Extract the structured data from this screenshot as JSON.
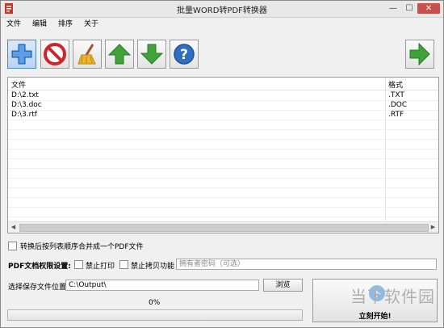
{
  "window": {
    "title": "批量WORD转PDF转换器",
    "minimize": "—",
    "maximize": "☐",
    "close": "✕"
  },
  "menu": [
    "文件",
    "编辑",
    "排序",
    "关于"
  ],
  "toolbar": {
    "buttons": [
      "add-icon",
      "delete-icon",
      "clear-icon",
      "move-up-icon",
      "move-down-icon",
      "help-icon"
    ],
    "next": "next-arrow-icon"
  },
  "file_list": {
    "columns": [
      "文件",
      "格式"
    ],
    "rows": [
      {
        "file": "D:\\2.txt",
        "format": ".TXT"
      },
      {
        "file": "D:\\3.doc",
        "format": ".DOC"
      },
      {
        "file": "D:\\3.rtf",
        "format": ".RTF"
      }
    ]
  },
  "options": {
    "merge_label": "转换后按列表顺序合并成一个PDF文件",
    "pdf_perm_label": "PDF文档权限设置:",
    "no_print_label": "禁止打印",
    "no_copy_label": "禁止拷贝功能",
    "password_placeholder": "拥有者密码（可选）"
  },
  "save": {
    "label": "选择保存文件位置",
    "path": "C:\\Output\\",
    "browse_label": "浏览"
  },
  "progress": {
    "text": "0%",
    "value": 0
  },
  "start_button": {
    "label": "立刻开始!"
  },
  "watermark": {
    "text": "当下软件园",
    "badge": "下"
  },
  "colors": {
    "accent": "#4f86c8",
    "green": "#3fa33a",
    "close": "#c7504c"
  }
}
